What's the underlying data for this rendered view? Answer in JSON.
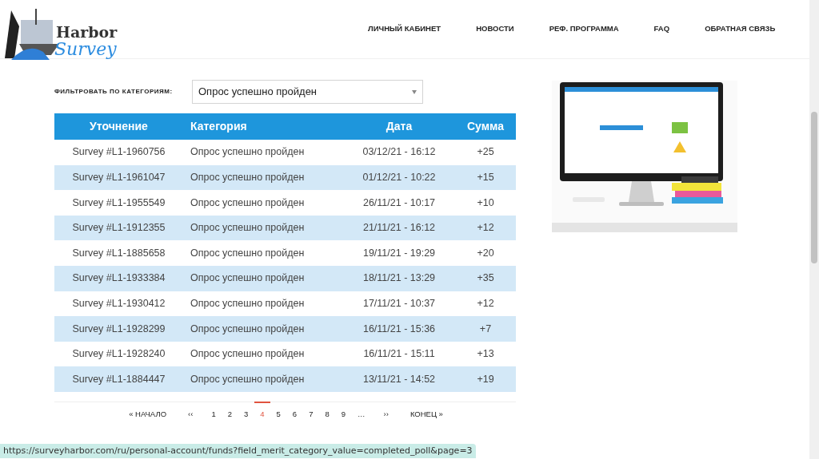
{
  "logo": {
    "line_1": "Harbor",
    "line_2": "Survey"
  },
  "nav": [
    "ЛИЧНЫЙ КАБИНЕТ",
    "НОВОСТИ",
    "РЕФ. ПРОГРАММА",
    "FAQ",
    "ОБРАТНАЯ СВЯЗЬ"
  ],
  "filter": {
    "label": "ФИЛЬТРОВАТЬ ПО КАТЕГОРИЯМ:",
    "value": "Опрос успешно пройден"
  },
  "table": {
    "columns": [
      "Уточнение",
      "Категория",
      "Дата",
      "Сумма"
    ],
    "rows": [
      [
        "Survey #L1-1960756",
        "Опрос успешно пройден",
        "03/12/21 - 16:12",
        "+25"
      ],
      [
        "Survey #L1-1961047",
        "Опрос успешно пройден",
        "01/12/21 - 10:22",
        "+15"
      ],
      [
        "Survey #L1-1955549",
        "Опрос успешно пройден",
        "26/11/21 - 10:17",
        "+10"
      ],
      [
        "Survey #L1-1912355",
        "Опрос успешно пройден",
        "21/11/21 - 16:12",
        "+12"
      ],
      [
        "Survey #L1-1885658",
        "Опрос успешно пройден",
        "19/11/21 - 19:29",
        "+20"
      ],
      [
        "Survey #L1-1933384",
        "Опрос успешно пройден",
        "18/11/21 - 13:29",
        "+35"
      ],
      [
        "Survey #L1-1930412",
        "Опрос успешно пройден",
        "17/11/21 - 10:37",
        "+12"
      ],
      [
        "Survey #L1-1928299",
        "Опрос успешно пройден",
        "16/11/21 - 15:36",
        "+7"
      ],
      [
        "Survey #L1-1928240",
        "Опрос успешно пройден",
        "16/11/21 - 15:11",
        "+13"
      ],
      [
        "Survey #L1-1884447",
        "Опрос успешно пройден",
        "13/11/21 - 14:52",
        "+19"
      ]
    ]
  },
  "pagination": [
    {
      "label": "« НАЧАЛО",
      "selected": false
    },
    {
      "label": "‹‹",
      "selected": false
    },
    {
      "label": "1",
      "selected": false
    },
    {
      "label": "2",
      "selected": false
    },
    {
      "label": "3",
      "selected": false
    },
    {
      "label": "4",
      "selected": true
    },
    {
      "label": "5",
      "selected": false
    },
    {
      "label": "6",
      "selected": false
    },
    {
      "label": "7",
      "selected": false
    },
    {
      "label": "8",
      "selected": false
    },
    {
      "label": "9",
      "selected": false
    },
    {
      "label": "…",
      "selected": false
    },
    {
      "label": "››",
      "selected": false
    },
    {
      "label": "КОНЕЦ »",
      "selected": false
    }
  ],
  "status_bar": {
    "url": "https://surveyharbor.com/ru/personal-account/funds?field_merit_category_value=completed_poll&page=3"
  }
}
